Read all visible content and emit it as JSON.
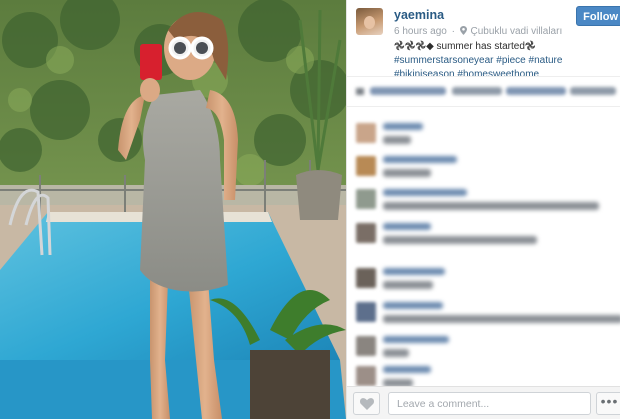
{
  "post": {
    "username": "yaemina",
    "time_ago": "6 hours ago",
    "location": "Çubuklu vadi villaları",
    "follow_label": "Follow",
    "caption_prefix": "𖣘𖣘𖣘◆",
    "caption_text": " summer has started",
    "caption_suffix": "𖣘 ",
    "hashtags": [
      "#summerstarsoneyear",
      "#piece",
      "#nature",
      "#bikiniseason",
      "#homesweethome"
    ]
  },
  "footer": {
    "comment_placeholder": "Leave a comment...",
    "more_label": "•••"
  },
  "icons": {
    "location": "location-pin-icon",
    "like": "heart-icon",
    "more": "ellipsis-icon"
  },
  "colors": {
    "link": "#2a5b84",
    "follow_button": "#4b88c5",
    "meta_text": "#9aa1a8"
  }
}
